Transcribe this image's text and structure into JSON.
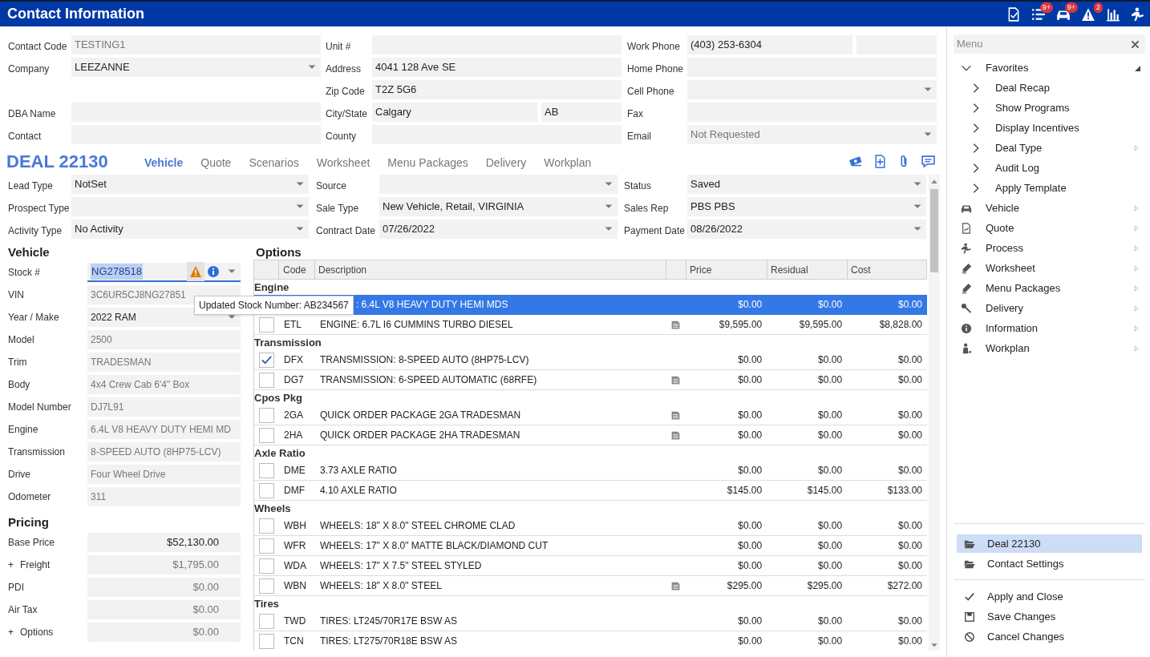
{
  "header": {
    "title": "Contact Information",
    "icons": [
      {
        "kind": "document"
      },
      {
        "kind": "list",
        "badge": "9+"
      },
      {
        "kind": "car",
        "badge": "9+"
      },
      {
        "kind": "warning",
        "badge": "2"
      },
      {
        "kind": "chart"
      },
      {
        "kind": "process"
      }
    ]
  },
  "contact": {
    "columns": [
      [
        {
          "label": "Contact Code",
          "value": "TESTING1",
          "readonly": true
        },
        {
          "label": "Company",
          "value": "LEEZANNE",
          "dropdown": true
        },
        {
          "kind": "gap"
        },
        {
          "label": "DBA Name"
        },
        {
          "label": "Contact"
        }
      ],
      [
        {
          "label": "Unit #"
        },
        {
          "label": "Address",
          "value": "4041 128 Ave SE"
        },
        {
          "label": "Zip Code",
          "value": "T2Z 5G6"
        },
        {
          "label": "City/State",
          "value": "Calgary",
          "second_value": "AB"
        },
        {
          "label": "County"
        }
      ],
      [
        {
          "label": "Work Phone",
          "value": "(403) 253-6304",
          "second_field": true
        },
        {
          "label": "Home Phone"
        },
        {
          "label": "Cell Phone",
          "dropdown": true
        },
        {
          "label": "Fax"
        },
        {
          "label": "Email",
          "value": "Not Requested",
          "readonly": true,
          "dropdown": true
        }
      ]
    ]
  },
  "deal": {
    "title": "DEAL 22130",
    "tabs": [
      {
        "label": "Vehicle",
        "selected": true
      },
      {
        "label": "Quote",
        "selected": false
      },
      {
        "label": "Scenarios",
        "selected": false
      },
      {
        "label": "Worksheet",
        "selected": false
      },
      {
        "label": "Menu Packages",
        "selected": false
      },
      {
        "label": "Delivery",
        "selected": false
      },
      {
        "label": "Workplan",
        "selected": false
      }
    ],
    "actions": [
      {
        "kind": "money"
      },
      {
        "kind": "add-document"
      },
      {
        "kind": "paperclip"
      },
      {
        "kind": "comment"
      }
    ],
    "columns": [
      [
        {
          "label": "Lead Type",
          "value": "NotSet",
          "dropdown": true
        },
        {
          "label": "Prospect Type",
          "dropdown": true
        },
        {
          "label": "Activity Type",
          "value": "No Activity",
          "dropdown": true
        }
      ],
      [
        {
          "label": "Source",
          "dropdown": true
        },
        {
          "label": "Sale Type",
          "value": "New Vehicle, Retail, VIRGINIA",
          "dropdown": true
        },
        {
          "label": "Contract Date",
          "value": "07/26/2022",
          "dropdown": true
        }
      ],
      [
        {
          "label": "Status",
          "value": "Saved",
          "dropdown": true
        },
        {
          "label": "Sales Rep",
          "value": "PBS PBS",
          "dropdown": true
        },
        {
          "label": "Payment Date",
          "value": "08/26/2022",
          "dropdown": true
        }
      ]
    ]
  },
  "vehicle": {
    "heading": "Vehicle",
    "fields": [
      {
        "kind": "stock",
        "label": "Stock #",
        "value": "NG278518",
        "dropdown": true
      },
      {
        "label": "VIN",
        "value": "3C6UR5CJ8NG27851",
        "readonly": true
      },
      {
        "label": "Year / Make",
        "value": "2022 RAM",
        "dropdown": true
      },
      {
        "label": "Model",
        "value": "2500",
        "readonly": true
      },
      {
        "label": "Trim",
        "value": "TRADESMAN",
        "readonly": true
      },
      {
        "label": "Body",
        "value": "4x4 Crew Cab 6'4\" Box",
        "readonly": true
      },
      {
        "label": "Model Number",
        "value": "DJ7L91",
        "readonly": true
      },
      {
        "label": "Engine",
        "value": "6.4L V8 HEAVY DUTY HEMI MD",
        "readonly": true
      },
      {
        "label": "Transmission",
        "value": "8-SPEED AUTO (8HP75-LCV)",
        "readonly": true
      },
      {
        "label": "Drive",
        "value": "Four Wheel Drive",
        "readonly": true
      },
      {
        "label": "Odometer",
        "value": "311",
        "readonly": true
      }
    ],
    "tooltip": "Updated Stock Number: AB234567"
  },
  "pricing": {
    "heading": "Pricing",
    "fields": [
      {
        "label": "Base Price",
        "value": "$52,130.00"
      },
      {
        "prefix": "+",
        "label": "Freight",
        "value": "$1,795.00",
        "readonly": true
      },
      {
        "label": "PDI",
        "value": "$0.00",
        "readonly": true
      },
      {
        "label": "Air Tax",
        "value": "$0.00",
        "readonly": true
      },
      {
        "prefix": "+",
        "label": "Options",
        "value": "$0.00",
        "readonly": true
      }
    ]
  },
  "options": {
    "heading": "Options",
    "columns": [
      "Code",
      "Description",
      "Price",
      "Residual",
      "Cost"
    ],
    "groups": [
      {
        "label": "Engine",
        "rows": [
          {
            "covered": true,
            "description": ": 6.4L V8 HEAVY DUTY HEMI MDS",
            "selected": true,
            "note": false,
            "price": "$0.00",
            "residual": "$0.00",
            "cost": "$0.00"
          },
          {
            "code": "ETL",
            "description": "ENGINE: 6.7L I6 CUMMINS TURBO DIESEL",
            "checked": false,
            "selected": false,
            "note": true,
            "price": "$9,595.00",
            "residual": "$9,595.00",
            "cost": "$8,828.00"
          }
        ]
      },
      {
        "label": "Transmission",
        "rows": [
          {
            "code": "DFX",
            "description": "TRANSMISSION: 8-SPEED AUTO (8HP75-LCV)",
            "checked": true,
            "selected": false,
            "note": false,
            "price": "$0.00",
            "residual": "$0.00",
            "cost": "$0.00"
          },
          {
            "code": "DG7",
            "description": "TRANSMISSION: 6-SPEED AUTOMATIC (68RFE)",
            "checked": false,
            "selected": false,
            "note": true,
            "price": "$0.00",
            "residual": "$0.00",
            "cost": "$0.00"
          }
        ]
      },
      {
        "label": "Cpos Pkg",
        "rows": [
          {
            "code": "2GA",
            "description": "QUICK ORDER PACKAGE 2GA TRADESMAN",
            "checked": false,
            "selected": false,
            "note": true,
            "price": "$0.00",
            "residual": "$0.00",
            "cost": "$0.00"
          },
          {
            "code": "2HA",
            "description": "QUICK ORDER PACKAGE 2HA TRADESMAN",
            "checked": false,
            "selected": false,
            "note": true,
            "price": "$0.00",
            "residual": "$0.00",
            "cost": "$0.00"
          }
        ]
      },
      {
        "label": "Axle Ratio",
        "rows": [
          {
            "code": "DME",
            "description": "3.73 AXLE RATIO",
            "checked": false,
            "selected": false,
            "note": false,
            "price": "$0.00",
            "residual": "$0.00",
            "cost": "$0.00"
          },
          {
            "code": "DMF",
            "description": "4.10 AXLE RATIO",
            "checked": false,
            "selected": false,
            "note": false,
            "price": "$145.00",
            "residual": "$145.00",
            "cost": "$133.00"
          }
        ]
      },
      {
        "label": "Wheels",
        "rows": [
          {
            "code": "WBH",
            "description": "WHEELS: 18\" X 8.0\" STEEL CHROME CLAD",
            "checked": false,
            "selected": false,
            "note": false,
            "price": "$0.00",
            "residual": "$0.00",
            "cost": "$0.00"
          },
          {
            "code": "WFR",
            "description": "WHEELS: 17\" X 8.0\" MATTE BLACK/DIAMOND CUT",
            "checked": false,
            "selected": false,
            "note": false,
            "price": "$0.00",
            "residual": "$0.00",
            "cost": "$0.00"
          },
          {
            "code": "WDA",
            "description": "WHEELS: 17\" X 7.5\" STEEL STYLED",
            "checked": false,
            "selected": false,
            "note": false,
            "price": "$0.00",
            "residual": "$0.00",
            "cost": "$0.00"
          },
          {
            "code": "WBN",
            "description": "WHEELS: 18\" X 8.0\" STEEL",
            "checked": false,
            "selected": false,
            "note": true,
            "price": "$295.00",
            "residual": "$295.00",
            "cost": "$272.00"
          }
        ]
      },
      {
        "label": "Tires",
        "rows": [
          {
            "code": "TWD",
            "description": "TIRES: LT245/70R17E BSW AS",
            "checked": false,
            "selected": false,
            "note": false,
            "price": "$0.00",
            "residual": "$0.00",
            "cost": "$0.00"
          },
          {
            "code": "TCN",
            "description": "TIRES: LT275/70R18E BSW AS",
            "checked": false,
            "selected": false,
            "note": false,
            "price": "$0.00",
            "residual": "$0.00",
            "cost": "$0.00"
          }
        ]
      }
    ]
  },
  "menu": {
    "placeholder": "Menu",
    "tree": [
      {
        "label": "Favorites",
        "expanded": true,
        "children": [
          {
            "label": "Deal Recap",
            "expanded": false
          },
          {
            "label": "Show Programs",
            "expanded": false
          },
          {
            "label": "Display Incentives",
            "expanded": false
          },
          {
            "label": "Deal Type",
            "expanded": false,
            "submenu": true
          },
          {
            "label": "Audit Log",
            "expanded": false
          },
          {
            "label": "Apply Template",
            "expanded": false
          }
        ]
      },
      {
        "label": "Vehicle",
        "kind": "car",
        "submenu": true
      },
      {
        "label": "Quote",
        "kind": "document",
        "submenu": true
      },
      {
        "label": "Process",
        "kind": "process",
        "submenu": true
      },
      {
        "label": "Worksheet",
        "kind": "pencil",
        "submenu": true
      },
      {
        "label": "Menu Packages",
        "kind": "pencil",
        "submenu": true
      },
      {
        "label": "Delivery",
        "kind": "wrench",
        "submenu": true
      },
      {
        "label": "Information",
        "kind": "info",
        "submenu": true
      },
      {
        "label": "Workplan",
        "kind": "person",
        "submenu": true
      }
    ],
    "documents": [
      {
        "label": "Deal 22130",
        "selected": true
      },
      {
        "label": "Contact Settings",
        "selected": false
      }
    ],
    "actions": [
      {
        "label": "Apply and Close",
        "kind": "check"
      },
      {
        "label": "Save Changes",
        "kind": "save"
      },
      {
        "label": "Cancel Changes",
        "kind": "cancel"
      }
    ]
  }
}
